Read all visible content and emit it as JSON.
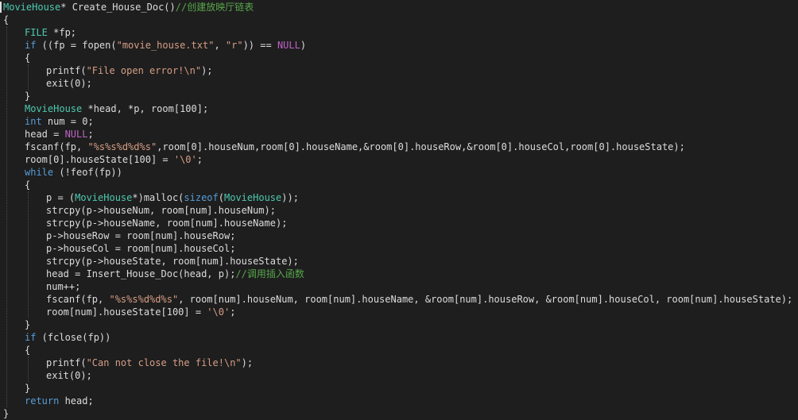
{
  "editor": {
    "theme": {
      "background": "#1e1e1e",
      "plain": "#dcdcdc",
      "type": "#4ec9b0",
      "keyword": "#569cd6",
      "macro": "#bd63c5",
      "string": "#d69d85",
      "comment": "#57a64a"
    },
    "lines": [
      {
        "indent": 0,
        "tokens": [
          {
            "c": "type",
            "t": "MovieHouse"
          },
          {
            "c": "plain",
            "t": "* Create_House_Doc()"
          },
          {
            "c": "cmt",
            "t": "//创建放映厅链表"
          }
        ]
      },
      {
        "indent": 0,
        "tokens": [
          {
            "c": "plain",
            "t": "{"
          }
        ]
      },
      {
        "indent": 1,
        "tokens": [
          {
            "c": "type",
            "t": "FILE"
          },
          {
            "c": "plain",
            "t": " *fp;"
          }
        ]
      },
      {
        "indent": 1,
        "tokens": [
          {
            "c": "kw",
            "t": "if"
          },
          {
            "c": "plain",
            "t": " ((fp = fopen("
          },
          {
            "c": "str",
            "t": "\"movie_house.txt\""
          },
          {
            "c": "plain",
            "t": ", "
          },
          {
            "c": "str",
            "t": "\"r\""
          },
          {
            "c": "plain",
            "t": ")) == "
          },
          {
            "c": "macro",
            "t": "NULL"
          },
          {
            "c": "plain",
            "t": ")"
          }
        ]
      },
      {
        "indent": 1,
        "tokens": [
          {
            "c": "plain",
            "t": "{"
          }
        ]
      },
      {
        "indent": 2,
        "tokens": [
          {
            "c": "plain",
            "t": "printf("
          },
          {
            "c": "str",
            "t": "\"File open error!\\n\""
          },
          {
            "c": "plain",
            "t": ");"
          }
        ]
      },
      {
        "indent": 2,
        "tokens": [
          {
            "c": "plain",
            "t": "exit(0);"
          }
        ]
      },
      {
        "indent": 1,
        "tokens": [
          {
            "c": "plain",
            "t": "}"
          }
        ]
      },
      {
        "indent": 1,
        "tokens": [
          {
            "c": "type",
            "t": "MovieHouse"
          },
          {
            "c": "plain",
            "t": " *head, *p, room[100];"
          }
        ]
      },
      {
        "indent": 1,
        "tokens": [
          {
            "c": "kw",
            "t": "int"
          },
          {
            "c": "plain",
            "t": " num = 0;"
          }
        ]
      },
      {
        "indent": 1,
        "tokens": [
          {
            "c": "plain",
            "t": "head = "
          },
          {
            "c": "macro",
            "t": "NULL"
          },
          {
            "c": "plain",
            "t": ";"
          }
        ]
      },
      {
        "indent": 1,
        "tokens": [
          {
            "c": "plain",
            "t": "fscanf(fp, "
          },
          {
            "c": "str",
            "t": "\"%s%s%d%d%s\""
          },
          {
            "c": "plain",
            "t": ",room[0].houseNum,room[0].houseName,&room[0].houseRow,&room[0].houseCol,room[0].houseState);"
          }
        ]
      },
      {
        "indent": 1,
        "tokens": [
          {
            "c": "plain",
            "t": "room[0].houseState[100] = "
          },
          {
            "c": "str",
            "t": "'\\0'"
          },
          {
            "c": "plain",
            "t": ";"
          }
        ]
      },
      {
        "indent": 1,
        "tokens": [
          {
            "c": "kw",
            "t": "while"
          },
          {
            "c": "plain",
            "t": " (!feof(fp))"
          }
        ]
      },
      {
        "indent": 1,
        "tokens": [
          {
            "c": "plain",
            "t": "{"
          }
        ]
      },
      {
        "indent": 2,
        "tokens": [
          {
            "c": "plain",
            "t": "p = ("
          },
          {
            "c": "type",
            "t": "MovieHouse"
          },
          {
            "c": "plain",
            "t": "*)malloc("
          },
          {
            "c": "kw",
            "t": "sizeof"
          },
          {
            "c": "plain",
            "t": "("
          },
          {
            "c": "type",
            "t": "MovieHouse"
          },
          {
            "c": "plain",
            "t": "));"
          }
        ]
      },
      {
        "indent": 2,
        "tokens": [
          {
            "c": "plain",
            "t": "strcpy(p->houseNum, room[num].houseNum);"
          }
        ]
      },
      {
        "indent": 2,
        "tokens": [
          {
            "c": "plain",
            "t": "strcpy(p->houseName, room[num].houseName);"
          }
        ]
      },
      {
        "indent": 2,
        "tokens": [
          {
            "c": "plain",
            "t": "p->houseRow = room[num].houseRow;"
          }
        ]
      },
      {
        "indent": 2,
        "tokens": [
          {
            "c": "plain",
            "t": "p->houseCol = room[num].houseCol;"
          }
        ]
      },
      {
        "indent": 2,
        "tokens": [
          {
            "c": "plain",
            "t": "strcpy(p->houseState, room[num].houseState);"
          }
        ]
      },
      {
        "indent": 2,
        "tokens": [
          {
            "c": "plain",
            "t": "head = Insert_House_Doc(head, p);"
          },
          {
            "c": "cmt",
            "t": "//调用插入函数"
          }
        ]
      },
      {
        "indent": 2,
        "tokens": [
          {
            "c": "plain",
            "t": "num++;"
          }
        ]
      },
      {
        "indent": 2,
        "tokens": [
          {
            "c": "plain",
            "t": "fscanf(fp, "
          },
          {
            "c": "str",
            "t": "\"%s%s%d%d%s\""
          },
          {
            "c": "plain",
            "t": ", room[num].houseNum, room[num].houseName, &room[num].houseRow, &room[num].houseCol, room[num].houseState);"
          }
        ]
      },
      {
        "indent": 2,
        "tokens": [
          {
            "c": "plain",
            "t": "room[num].houseState[100] = "
          },
          {
            "c": "str",
            "t": "'\\0'"
          },
          {
            "c": "plain",
            "t": ";"
          }
        ]
      },
      {
        "indent": 1,
        "tokens": [
          {
            "c": "plain",
            "t": "}"
          }
        ]
      },
      {
        "indent": 1,
        "tokens": [
          {
            "c": "kw",
            "t": "if"
          },
          {
            "c": "plain",
            "t": " (fclose(fp))"
          }
        ]
      },
      {
        "indent": 1,
        "tokens": [
          {
            "c": "plain",
            "t": "{"
          }
        ]
      },
      {
        "indent": 2,
        "tokens": [
          {
            "c": "plain",
            "t": "printf("
          },
          {
            "c": "str",
            "t": "\"Can not close the file!\\n\""
          },
          {
            "c": "plain",
            "t": ");"
          }
        ]
      },
      {
        "indent": 2,
        "tokens": [
          {
            "c": "plain",
            "t": "exit(0);"
          }
        ]
      },
      {
        "indent": 1,
        "tokens": [
          {
            "c": "plain",
            "t": "}"
          }
        ]
      },
      {
        "indent": 1,
        "tokens": [
          {
            "c": "kw",
            "t": "return"
          },
          {
            "c": "plain",
            "t": " head;"
          }
        ]
      },
      {
        "indent": 0,
        "tokens": [
          {
            "c": "plain",
            "t": "}"
          }
        ]
      }
    ]
  }
}
